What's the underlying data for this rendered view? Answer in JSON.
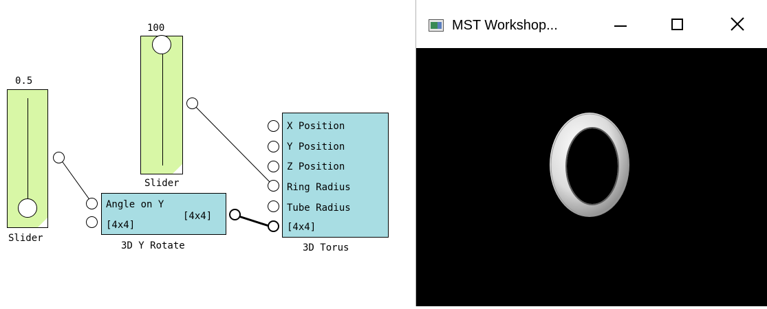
{
  "canvas": {
    "slider_left": {
      "value": "0.5",
      "caption": "Slider"
    },
    "slider_top": {
      "value": "100",
      "caption": "Slider"
    },
    "rotate_block": {
      "inputs": [
        "Angle on Y",
        "[4x4]"
      ],
      "output": "[4x4]",
      "caption": "3D Y Rotate"
    },
    "torus_block": {
      "inputs": [
        "X Position",
        "Y Position",
        "Z Position",
        "Ring Radius",
        "Tube Radius",
        "[4x4]"
      ],
      "caption": "3D Torus"
    }
  },
  "window": {
    "title": "MST Workshop...",
    "icon": "app-window-icon",
    "controls": [
      "minimize-icon",
      "maximize-icon",
      "close-icon"
    ]
  },
  "colors": {
    "slider_fill": "#d8f7a6",
    "block_fill": "#a8dde3",
    "viewport_bg": "#000000",
    "torus": "#e8e8e8"
  }
}
